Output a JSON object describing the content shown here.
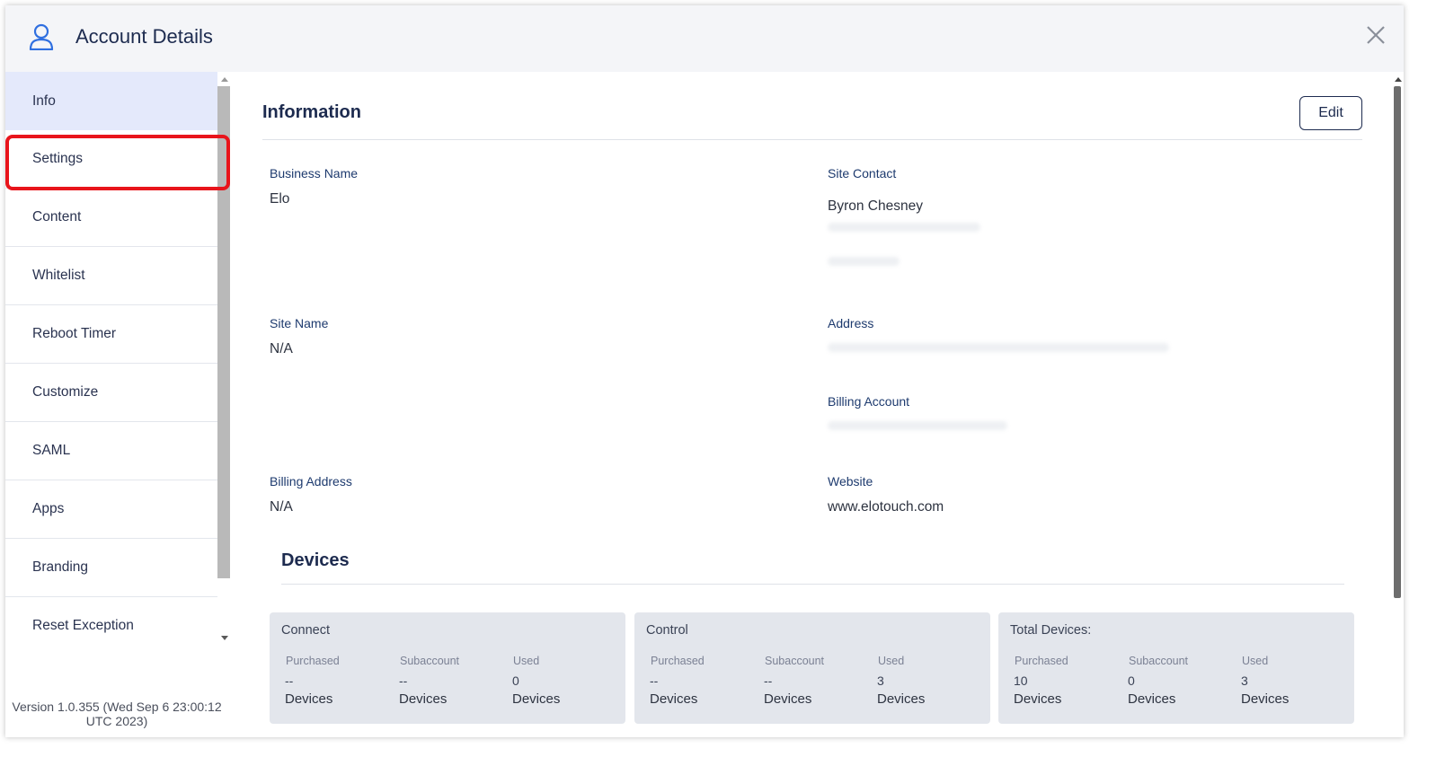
{
  "header": {
    "title": "Account Details"
  },
  "sidebar": {
    "items": [
      {
        "label": "Info"
      },
      {
        "label": "Settings"
      },
      {
        "label": "Content"
      },
      {
        "label": "Whitelist"
      },
      {
        "label": "Reboot Timer"
      },
      {
        "label": "Customize"
      },
      {
        "label": "SAML"
      },
      {
        "label": "Apps"
      },
      {
        "label": "Branding"
      },
      {
        "label": "Reset Exception"
      }
    ],
    "active_item": "Info",
    "version_line1": "Version 1.0.355 (Wed Sep 6 23:00:12",
    "version_line2": "UTC 2023)"
  },
  "information": {
    "title": "Information",
    "edit_label": "Edit",
    "business_name_label": "Business Name",
    "business_name_value": "Elo",
    "site_contact_label": "Site Contact",
    "site_contact_value": "Byron Chesney",
    "site_name_label": "Site Name",
    "site_name_value": "N/A",
    "address_label": "Address",
    "billing_account_label": "Billing Account",
    "billing_address_label": "Billing Address",
    "billing_address_value": "N/A",
    "website_label": "Website",
    "website_value": "www.elotouch.com"
  },
  "devices": {
    "title": "Devices",
    "cards": [
      {
        "title": "Connect",
        "purchased_label": "Purchased",
        "purchased_value": "--",
        "subaccount_label": "Subaccount",
        "subaccount_value": "--",
        "used_label": "Used",
        "used_value": "0",
        "unit": "Devices"
      },
      {
        "title": "Control",
        "purchased_label": "Purchased",
        "purchased_value": "--",
        "subaccount_label": "Subaccount",
        "subaccount_value": "--",
        "used_label": "Used",
        "used_value": "3",
        "unit": "Devices"
      },
      {
        "title": "Total Devices:",
        "purchased_label": "Purchased",
        "purchased_value": "10",
        "subaccount_label": "Subaccount",
        "subaccount_value": "0",
        "used_label": "Used",
        "used_value": "3",
        "unit": "Devices"
      }
    ]
  },
  "colors": {
    "active_nav_bg": "#e4e9fb",
    "highlight_border": "#e8141b",
    "accent_icon": "#2f6fe0",
    "card_bg": "#e3e6ec"
  },
  "icons": {
    "header": "user-icon",
    "close": "close-icon"
  }
}
